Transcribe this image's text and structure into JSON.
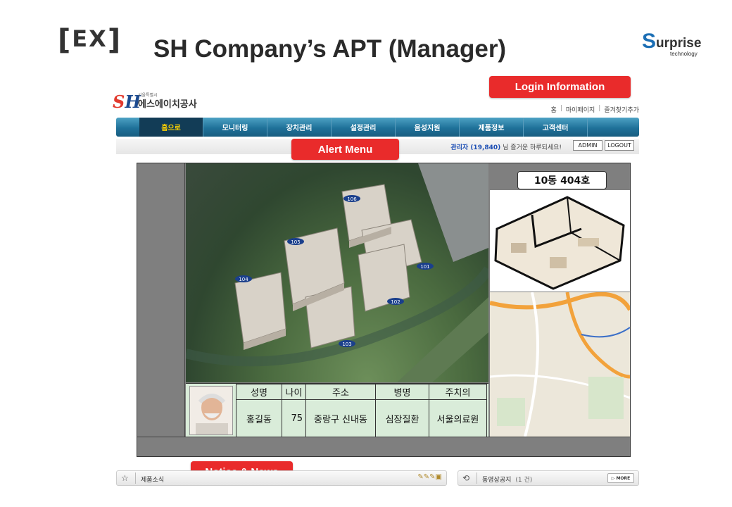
{
  "slide": {
    "tag": "EX",
    "title": "SH Company’s APT (Manager)",
    "brand": {
      "initial": "S",
      "rest": "urprise",
      "sub": "technology"
    }
  },
  "site": {
    "logo": {
      "mark": "SH",
      "small": "서울특별시",
      "name": "에스에이치공사"
    },
    "util_links": [
      "홈",
      "마이페이지",
      "즐겨찾기추가"
    ],
    "nav": [
      "홈으로",
      "모니터링",
      "장치관리",
      "설정관리",
      "음성지원",
      "제품정보",
      "고객센터"
    ],
    "active_nav_index": 0,
    "user": {
      "name": "관리자 (19,840)",
      "greeting": " 님 즐거운 하루되세요!",
      "admin_label": "ADMIN",
      "logout_label": "LOGOUT"
    }
  },
  "callouts": {
    "login": "Login Information",
    "alert": "Alert Menu",
    "notice": "Notice & News"
  },
  "panel": {
    "unit_label": "10동 404호",
    "buildings": [
      "106",
      "105",
      "104",
      "101",
      "102",
      "103"
    ],
    "patient": {
      "headers": [
        "성명",
        "나이",
        "주소",
        "병명",
        "주치의"
      ],
      "row": [
        "홍길동",
        "75",
        "중랑구 신내동",
        "심장질환",
        "서울의료원"
      ]
    }
  },
  "widgets": {
    "left": {
      "title": "제품소식"
    },
    "right": {
      "title": "동영상공지",
      "count": "(1 건)",
      "more": "MORE"
    }
  }
}
